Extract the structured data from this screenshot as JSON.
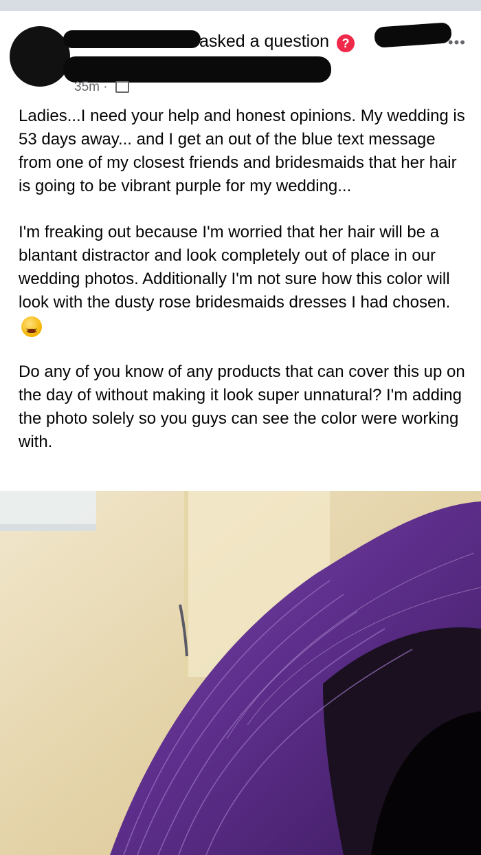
{
  "post": {
    "action_text": "asked a question",
    "question_badge": "?",
    "timestamp": "35m",
    "more_icon": "more-horizontal-icon",
    "paragraphs": [
      "Ladies...I need your help and honest opinions. My wedding is 53 days away... and I get an out of the blue text message from one of my closest friends and bridesmaids that her hair is going to be vibrant purple for my wedding...",
      "I'm freaking out because I'm worried that her hair will be a blantant distractor and look completely out of place in our wedding photos. Additionally I'm not sure how this color will look with the dusty rose bridesmaids dresses I had chosen.",
      "Do any of you know of any products that can cover this up on the day of without making it look super unnatural? I'm adding the photo solely so you guys can see the color were working with."
    ],
    "emoji": "tired-face-emoji",
    "photo": "purple-hair-photo"
  },
  "colors": {
    "top_strip": "#d8dde3",
    "question_badge": "#f02849",
    "meta_text": "#65676b",
    "hair_purple": "#5b2a86"
  }
}
